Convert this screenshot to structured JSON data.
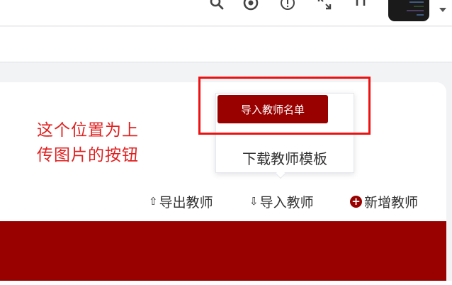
{
  "header": {
    "icons": [
      "search-icon",
      "github-icon",
      "help-icon",
      "fullscreen-icon",
      "font-size-icon"
    ],
    "avatar_icon": "avatar-image"
  },
  "annotation": {
    "line1": "这个位置为上",
    "line2": "传图片的按钮",
    "color": "#e02020"
  },
  "dropdown": {
    "import_names_label": "导入教师名单",
    "download_template_label": "下载教师模板"
  },
  "actions": {
    "export_label": "导出教师",
    "import_label": "导入教师",
    "add_label": "新增教师",
    "export_icon": "upload-icon",
    "import_icon": "download-icon",
    "add_icon": "plus-circle-icon"
  },
  "theme": {
    "primary": "#990000",
    "highlight": "#ee1111"
  }
}
